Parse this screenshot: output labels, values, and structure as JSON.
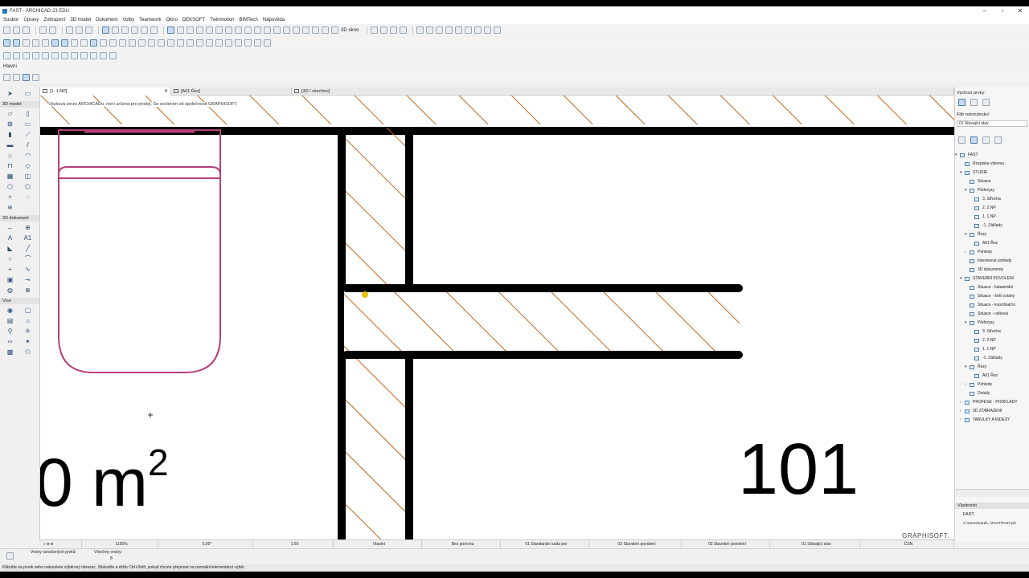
{
  "window": {
    "title": "FAST - ARCHICAD 23 EDU",
    "controls": [
      "–",
      "▫",
      "✕"
    ]
  },
  "menu": [
    "Soubor",
    "Úpravy",
    "Zobrazení",
    "3D model",
    "Dokument",
    "Volby",
    "Teamwork",
    "Okno",
    "DEKSOFT",
    "Twinmotion",
    "BIMTech",
    "Nápověda"
  ],
  "toolbar": {
    "view_3d_label": "3D okno",
    "palette_label": "Hlavní"
  },
  "tabs": [
    {
      "label": "[1. 1.NP]",
      "active": true
    },
    {
      "label": "[A01 Řez]",
      "active": false
    },
    {
      "label": "[3D / všechno]",
      "active": false
    }
  ],
  "toolbox": {
    "select_label": "Výběr",
    "section_3d": "3D model",
    "section_2d": "2D dokument",
    "section_more": "Více",
    "label_a1": "A1"
  },
  "canvas": {
    "notice": "Výuková verze ARCHICADu, není určena pro prodej. Se svolením od společnosti GRAPHISOFT.",
    "area_value": "0 m",
    "area_exp": "2",
    "room_number": "101",
    "watermark": "GRAPHISOFT."
  },
  "navigator": {
    "header": "Výchozí prvky:",
    "filter_label": "Filtr rekonstrukcí",
    "filter_value": "01 Stávající stav",
    "tree": [
      {
        "label": "FAST",
        "level": 0,
        "arrow": "▾"
      },
      {
        "label": "Rozpiska výkresu",
        "level": 1,
        "arrow": ""
      },
      {
        "label": "STUDIE",
        "level": 1,
        "arrow": "▾"
      },
      {
        "label": "Situace",
        "level": 2,
        "arrow": ""
      },
      {
        "label": "Půdorysy",
        "level": 2,
        "arrow": "▾"
      },
      {
        "label": "3. Střecha",
        "level": 3,
        "arrow": ""
      },
      {
        "label": "2. 2.NP",
        "level": 3,
        "arrow": ""
      },
      {
        "label": "1. 1.NP",
        "level": 3,
        "arrow": ""
      },
      {
        "label": "-1. Základy",
        "level": 3,
        "arrow": ""
      },
      {
        "label": "Řezy",
        "level": 2,
        "arrow": "▾"
      },
      {
        "label": "A01 Řez",
        "level": 3,
        "arrow": ""
      },
      {
        "label": "Pohledy",
        "level": 2,
        "arrow": "›"
      },
      {
        "label": "Interiérové pohledy",
        "level": 2,
        "arrow": ""
      },
      {
        "label": "3D dokumenty",
        "level": 2,
        "arrow": ""
      },
      {
        "label": "STAVEBNÍ POVOLENÍ",
        "level": 1,
        "arrow": "▾"
      },
      {
        "label": "Situace - katastrální",
        "level": 2,
        "arrow": ""
      },
      {
        "label": "Situace - širší vztahy",
        "level": 2,
        "arrow": ""
      },
      {
        "label": "Situace - koordinační",
        "level": 2,
        "arrow": ""
      },
      {
        "label": "Situace - celková",
        "level": 2,
        "arrow": ""
      },
      {
        "label": "Půdorysy",
        "level": 2,
        "arrow": "▾"
      },
      {
        "label": "3. Střecha",
        "level": 3,
        "arrow": ""
      },
      {
        "label": "2. 2.NP",
        "level": 3,
        "arrow": ""
      },
      {
        "label": "1. 1.NP",
        "level": 3,
        "arrow": ""
      },
      {
        "label": "-1. Základy",
        "level": 3,
        "arrow": ""
      },
      {
        "label": "Řezy",
        "level": 2,
        "arrow": "▾"
      },
      {
        "label": "A01 Řez",
        "level": 3,
        "arrow": ""
      },
      {
        "label": "Pohledy",
        "level": 2,
        "arrow": "›"
      },
      {
        "label": "Detaily",
        "level": 2,
        "arrow": ""
      },
      {
        "label": "PROFESE - PODKLADY",
        "level": 1,
        "arrow": "›"
      },
      {
        "label": "3D ZOBRAZENÍ",
        "level": 1,
        "arrow": "›"
      },
      {
        "label": "TABULKY A INDEXY",
        "level": 1,
        "arrow": "›"
      }
    ],
    "properties_header": "Vlastnosti",
    "properties_name": "FAST",
    "properties_path": "C:\\Users\\Karel\\...\\FAST\\FAST.pln"
  },
  "statusbar": {
    "zoom": "1155%",
    "angle": "0,00°",
    "scale": "1:50",
    "pen_set": "Vlastní",
    "surface": "Bez povrchu",
    "model_set": "01 Standardní sada per",
    "layer_combo": "03 Stavební povolení",
    "view_filter": "03 Stavební povolení",
    "renovation": "01 Stávající stav",
    "standard": "ČSN"
  },
  "infobar": {
    "layers_label": "Vrstvy označených prvků:",
    "all_layers_label": "Všechny vrstvy:",
    "all_layers_value": "8"
  },
  "hint": "Klikněte na prvek nebo nakreslete výběrový obrazec. Stiskněte a držte Ctrl+Shift, pokud chcete přepnout na normální/elementární výběr.",
  "colors": {
    "hatch": "#c0661e",
    "furniture": "#b5407a",
    "wall": "#000000",
    "accent": "#2a7ab8"
  }
}
